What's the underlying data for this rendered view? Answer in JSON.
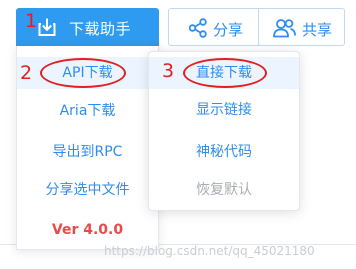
{
  "toolbar": {
    "download_helper_label": "下载助手",
    "share_label": "分享",
    "team_label": "共享"
  },
  "download_menu": {
    "items": [
      {
        "label": "API下载"
      },
      {
        "label": "Aria下载"
      },
      {
        "label": "导出到RPC"
      },
      {
        "label": "分享选中文件"
      }
    ],
    "version": "Ver 4.0.0"
  },
  "api_submenu": {
    "items": [
      {
        "label": "直接下载"
      },
      {
        "label": "显示链接"
      },
      {
        "label": "神秘代码"
      },
      {
        "label": "恢复默认"
      }
    ]
  },
  "annotations": [
    "1",
    "2",
    "3"
  ],
  "watermark": "https://blog.csdn.net/qq_45021180",
  "colors": {
    "accent": "#2e9bf0",
    "link": "#2e8df0",
    "annotation_red": "#e02020",
    "version_red": "#e84a4a"
  }
}
